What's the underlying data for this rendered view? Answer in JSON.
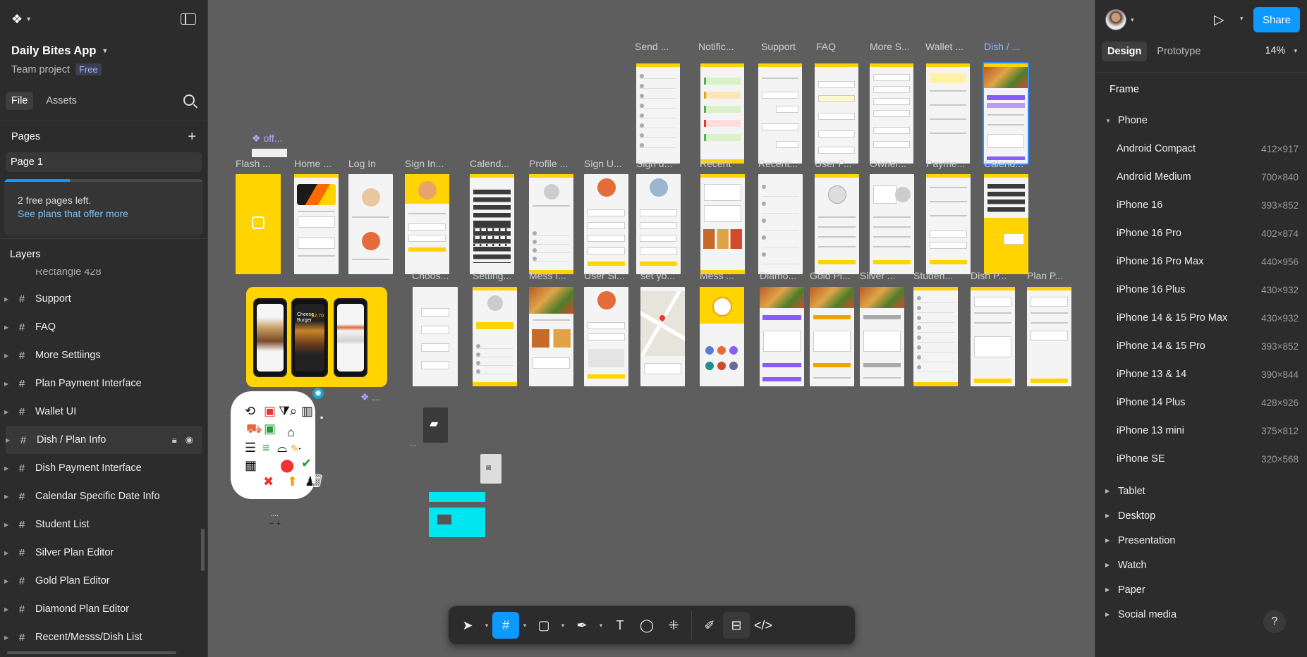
{
  "left_panel": {
    "file_name": "Daily Bites App",
    "team": "Team project",
    "plan_badge": "Free",
    "tabs": [
      "File",
      "Assets"
    ],
    "pages_title": "Pages",
    "page_name": "Page 1",
    "upsell": {
      "text": "2 free pages left.",
      "link": "See plans that offer more",
      "progress": 0.33
    },
    "layers_title": "Layers",
    "partial_layer": "Rectangle 428",
    "layers": [
      "Support",
      "FAQ",
      "More Settiings",
      "Plan Payment Interface",
      "Wallet UI",
      "Dish / Plan Info",
      "Dish Payment Interface",
      "Calendar Specific Date Info",
      "Student List",
      "Silver Plan Editor",
      "Gold Plan Editor",
      "Diamond Plan Editor",
      "Recent/Messs/Dish List"
    ],
    "selected_layer": "Dish / Plan Info"
  },
  "canvas": {
    "frame_labels_row1": [
      "Send ...",
      "Notific...",
      "Support",
      "FAQ",
      "More S...",
      "Wallet ...",
      "Dish / ..."
    ],
    "frame_labels_row2": [
      "Flash ...",
      "Home ...",
      "Log In",
      "Sign In...",
      "Calend...",
      "Profile ...",
      "Sign U...",
      "Sign u...",
      "Recent",
      "Recent...",
      "User P...",
      "Owner...",
      "Payme...",
      "Calend..."
    ],
    "frame_labels_row3": [
      "Choos...",
      "Setting...",
      "Mess I...",
      "User Si...",
      "set yo...",
      "Mess ...",
      "Diamo...",
      "Gold Pl...",
      "Silver ...",
      "Studen...",
      "Dish P...",
      "Plan P..."
    ],
    "component_labels": [
      "off...",
      "...",
      "...",
      "...."
    ],
    "showcase_texts": [
      "Cheese Burger",
      "$2.70"
    ]
  },
  "toolbar": {
    "tools": [
      "move-tool",
      "frame-tool",
      "shape-tool",
      "pen-tool",
      "text-tool",
      "comment-tool",
      "actions-tool",
      "draw-mode",
      "design-mode",
      "dev-mode"
    ],
    "text_tool_glyph": "T",
    "active_tool": "frame-tool"
  },
  "right_panel": {
    "share_label": "Share",
    "tabs": [
      "Design",
      "Prototype"
    ],
    "zoom": "14%",
    "section_title": "Frame",
    "phone_group": "Phone",
    "presets": [
      {
        "name": "Android Compact",
        "size": "412×917"
      },
      {
        "name": "Android Medium",
        "size": "700×840"
      },
      {
        "name": "iPhone 16",
        "size": "393×852"
      },
      {
        "name": "iPhone 16 Pro",
        "size": "402×874"
      },
      {
        "name": "iPhone 16 Pro Max",
        "size": "440×956"
      },
      {
        "name": "iPhone 16 Plus",
        "size": "430×932"
      },
      {
        "name": "iPhone 14 & 15 Pro Max",
        "size": "430×932"
      },
      {
        "name": "iPhone 14 & 15 Pro",
        "size": "393×852"
      },
      {
        "name": "iPhone 13 & 14",
        "size": "390×844"
      },
      {
        "name": "iPhone 14 Plus",
        "size": "428×926"
      },
      {
        "name": "iPhone 13 mini",
        "size": "375×812"
      },
      {
        "name": "iPhone SE",
        "size": "320×568"
      }
    ],
    "groups": [
      "Tablet",
      "Desktop",
      "Presentation",
      "Watch",
      "Paper",
      "Social media"
    ],
    "help": "?"
  }
}
